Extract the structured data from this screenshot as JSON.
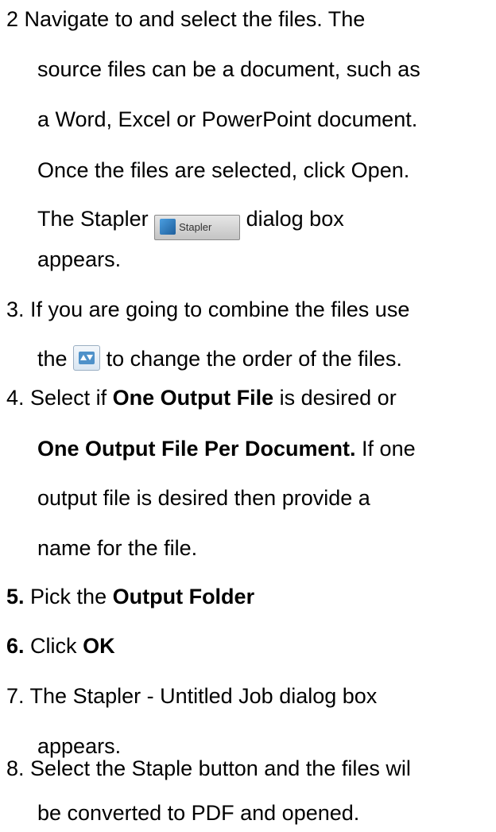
{
  "step2": {
    "line1": "2 Navigate to and select the files. The",
    "line2": "source files can be a document, such as",
    "line3": "a Word, Excel or PowerPoint document.",
    "line4": "Once the files are selected, click Open.",
    "line5_pre": "The Stapler",
    "stapler_icon_label": "Stapler",
    "line5_post": "dialog box",
    "line6": "appears."
  },
  "step3": {
    "num": "3.",
    "line1": "If you are going to combine the files use",
    "line2_pre": "the",
    "line2_post": "to change the order of the files."
  },
  "step4": {
    "num": "4.",
    "line1_pre": "Select if",
    "line1_bold": "One Output File",
    "line1_post": "is desired or",
    "line2_bold": "One Output File Per Document.",
    "line2_post": "If one",
    "line3": "output file is desired then provide a",
    "line4": "name for the file."
  },
  "step5": {
    "num": "5.",
    "pre": "Pick the",
    "bold": "Output Folder"
  },
  "step6": {
    "num": "6.",
    "pre": "Click",
    "bold": "OK"
  },
  "step7": {
    "num": "7.",
    "line1": "The Stapler - Untitled Job dialog box",
    "line2": "appears."
  },
  "step8": {
    "num": "8.",
    "line1": "Select the Staple button and the files wil",
    "line2": "be converted to PDF and opened."
  }
}
